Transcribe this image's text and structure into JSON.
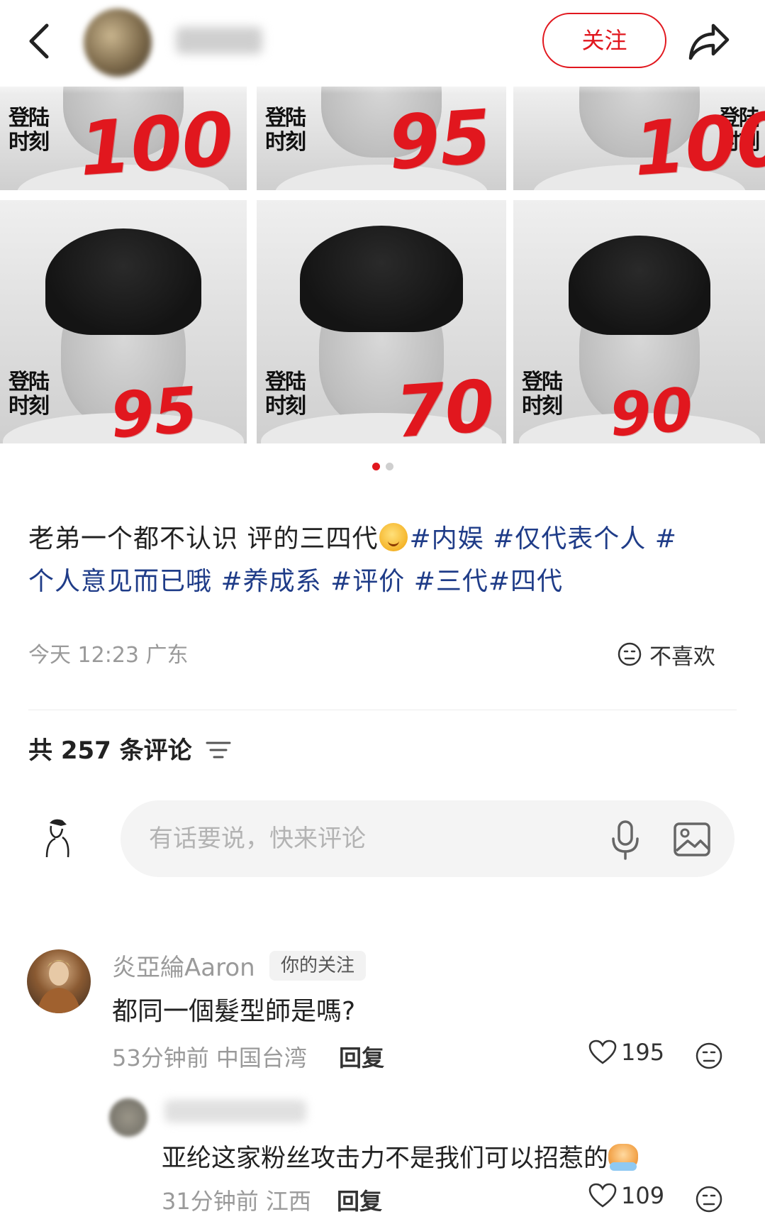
{
  "header": {
    "follow_label": "关注"
  },
  "images": {
    "brand_line1": "登陆",
    "brand_line2": "时刻",
    "scores": [
      "100",
      "95",
      "100",
      "95",
      "70",
      "90"
    ]
  },
  "pager": {
    "count": 2,
    "active": 0
  },
  "post": {
    "text_plain_1": "老弟一个都不认识 评的三四代",
    "tag_1": "#内娱",
    "tag_2": "#仅代表个人",
    "tag_3": "#",
    "line2_tag_a": "个人意见而已哦",
    "tag_4": "#养成系",
    "tag_5": "#评价",
    "tag_6": "#三代",
    "tag_7": "#四代",
    "meta": "今天 12:23 广东",
    "dislike_label": "不喜欢"
  },
  "comments_header": {
    "count_label": "共 257 条评论"
  },
  "comment_input": {
    "placeholder": "有话要说，快来评论"
  },
  "comments": [
    {
      "name": "炎亞綸Aaron",
      "badge": "你的关注",
      "text": "都同一個髮型師是嗎?",
      "time_location": "53分钟前 中国台湾",
      "reply_label": "回复",
      "likes": "195"
    },
    {
      "text": "亚纶这家粉丝攻击力不是我们可以招惹的",
      "time_location": "31分钟前 江西",
      "reply_label": "回复",
      "likes": "109"
    }
  ],
  "colors": {
    "accent": "#e1171e",
    "tag": "#1f3c88",
    "muted": "#9a9a9a"
  }
}
